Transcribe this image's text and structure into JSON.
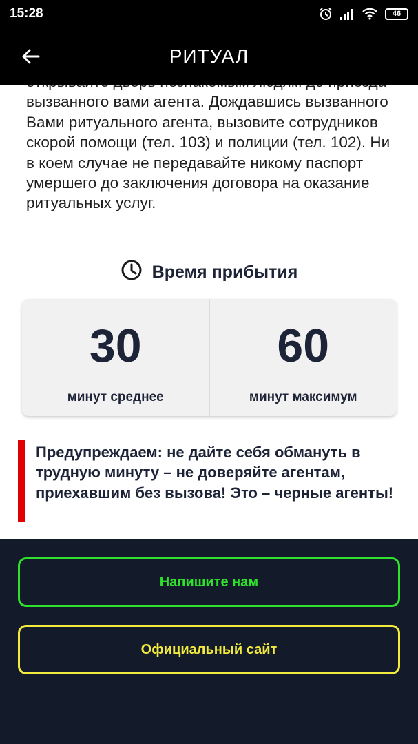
{
  "status_bar": {
    "time": "15:28",
    "battery": "46"
  },
  "app_bar": {
    "title": "РИТУАЛ"
  },
  "body_text": "открывайте дверь незнакомым людям до приезда вызванного вами агента. Дождавшись вызванного Вами ритуального агента, вызовите сотрудников скорой помощи (тел. 103) и полиции (тел. 102).  Ни в коем случае не передавайте никому паспорт умершего до заключения договора на оказание ритуальных услуг.",
  "arrival": {
    "heading": "Время прибытия",
    "stats": [
      {
        "value": "30",
        "label": "минут среднее"
      },
      {
        "value": "60",
        "label": "минут максимум"
      }
    ]
  },
  "warning": "Предупреждаем: не дайте себя обмануть в трудную минуту – не доверяйте агентам, приехавшим без вызова! Это – черные агенты!",
  "buttons": {
    "write_us": "Напишите нам",
    "official_site": "Официальный сайт"
  },
  "colors": {
    "accent_green": "#2fe02c",
    "accent_yellow": "#f2ea3c",
    "warning_red": "#e00000",
    "footer_bg": "#131a2a"
  }
}
